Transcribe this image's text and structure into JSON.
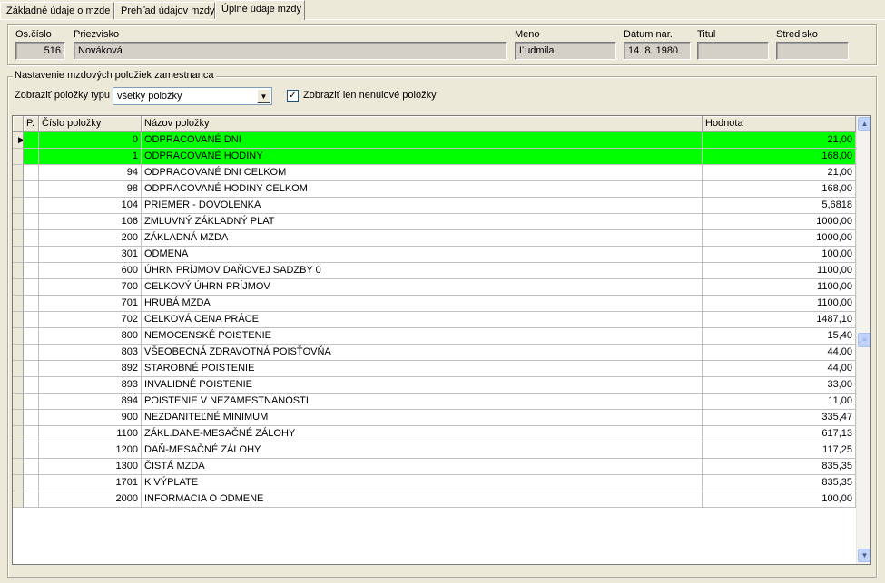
{
  "tabs": [
    {
      "label": "Základné údaje o mzde"
    },
    {
      "label": "Prehľad údajov mzdy"
    },
    {
      "label": "Úplné údaje mzdy"
    }
  ],
  "header": {
    "os_cislo_label": "Os.číslo",
    "os_cislo_value": "516",
    "priezvisko_label": "Priezvisko",
    "priezvisko_value": "Nováková",
    "meno_label": "Meno",
    "meno_value": "Ľudmila",
    "datum_label": "Dátum nar.",
    "datum_value": "14. 8. 1980",
    "titul_label": "Titul",
    "titul_value": "",
    "stredisko_label": "Stredisko",
    "stredisko_value": ""
  },
  "group": {
    "title": "Nastavenie mzdových položiek zamestnanca",
    "filter_label": "Zobraziť položky typu",
    "filter_value": "všetky položky",
    "nonzero_label": "Zobraziť len nenulové položky",
    "nonzero_checked": "✓"
  },
  "grid": {
    "columns": {
      "p": "P.",
      "cislo": "Číslo položky",
      "nazov": "Názov položky",
      "hodnota": "Hodnota"
    },
    "rows": [
      {
        "cislo": "0",
        "nazov": "ODPRACOVANÉ DNI",
        "hodnota": "21,00",
        "highlight": true,
        "current": true
      },
      {
        "cislo": "1",
        "nazov": "ODPRACOVANÉ HODINY",
        "hodnota": "168,00",
        "highlight": true
      },
      {
        "cislo": "94",
        "nazov": "ODPRACOVANÉ DNI CELKOM",
        "hodnota": "21,00"
      },
      {
        "cislo": "98",
        "nazov": "ODPRACOVANÉ HODINY CELKOM",
        "hodnota": "168,00"
      },
      {
        "cislo": "104",
        "nazov": "PRIEMER - DOVOLENKA",
        "hodnota": "5,6818"
      },
      {
        "cislo": "106",
        "nazov": "ZMLUVNÝ ZÁKLADNÝ PLAT",
        "hodnota": "1000,00"
      },
      {
        "cislo": "200",
        "nazov": "ZÁKLADNÁ MZDA",
        "hodnota": "1000,00"
      },
      {
        "cislo": "301",
        "nazov": "ODMENA",
        "hodnota": "100,00"
      },
      {
        "cislo": "600",
        "nazov": "ÚHRN PRÍJMOV DAŇOVEJ SADZBY 0",
        "hodnota": "1100,00"
      },
      {
        "cislo": "700",
        "nazov": "CELKOVÝ ÚHRN PRÍJMOV",
        "hodnota": "1100,00"
      },
      {
        "cislo": "701",
        "nazov": "HRUBÁ MZDA",
        "hodnota": "1100,00"
      },
      {
        "cislo": "702",
        "nazov": "CELKOVÁ CENA PRÁCE",
        "hodnota": "1487,10"
      },
      {
        "cislo": "800",
        "nazov": "NEMOCENSKÉ POISTENIE",
        "hodnota": "15,40"
      },
      {
        "cislo": "803",
        "nazov": "VŠEOBECNÁ ZDRAVOTNÁ POISŤOVŇA",
        "hodnota": "44,00"
      },
      {
        "cislo": "892",
        "nazov": "STAROBNÉ POISTENIE",
        "hodnota": "44,00"
      },
      {
        "cislo": "893",
        "nazov": "INVALIDNÉ POISTENIE",
        "hodnota": "33,00"
      },
      {
        "cislo": "894",
        "nazov": "POISTENIE V NEZAMESTNANOSTI",
        "hodnota": "11,00"
      },
      {
        "cislo": "900",
        "nazov": "NEZDANITEĽNÉ MINIMUM",
        "hodnota": "335,47"
      },
      {
        "cislo": "1100",
        "nazov": "ZÁKL.DANE-MESAČNÉ ZÁLOHY",
        "hodnota": "617,13"
      },
      {
        "cislo": "1200",
        "nazov": "DAŇ-MESAČNÉ ZÁLOHY",
        "hodnota": "117,25"
      },
      {
        "cislo": "1300",
        "nazov": "ČISTÁ MZDA",
        "hodnota": "835,35"
      },
      {
        "cislo": "1701",
        "nazov": "K VÝPLATE",
        "hodnota": "835,35"
      },
      {
        "cislo": "2000",
        "nazov": "INFORMACIA O ODMENE",
        "hodnota": "100,00"
      }
    ],
    "highlight_color": "#00ff00"
  },
  "icons": {
    "row_pointer": "▶",
    "scroll_up": "▲",
    "scroll_down": "▼",
    "combo_arrow": "▼",
    "scroll_thumb": "≡"
  }
}
